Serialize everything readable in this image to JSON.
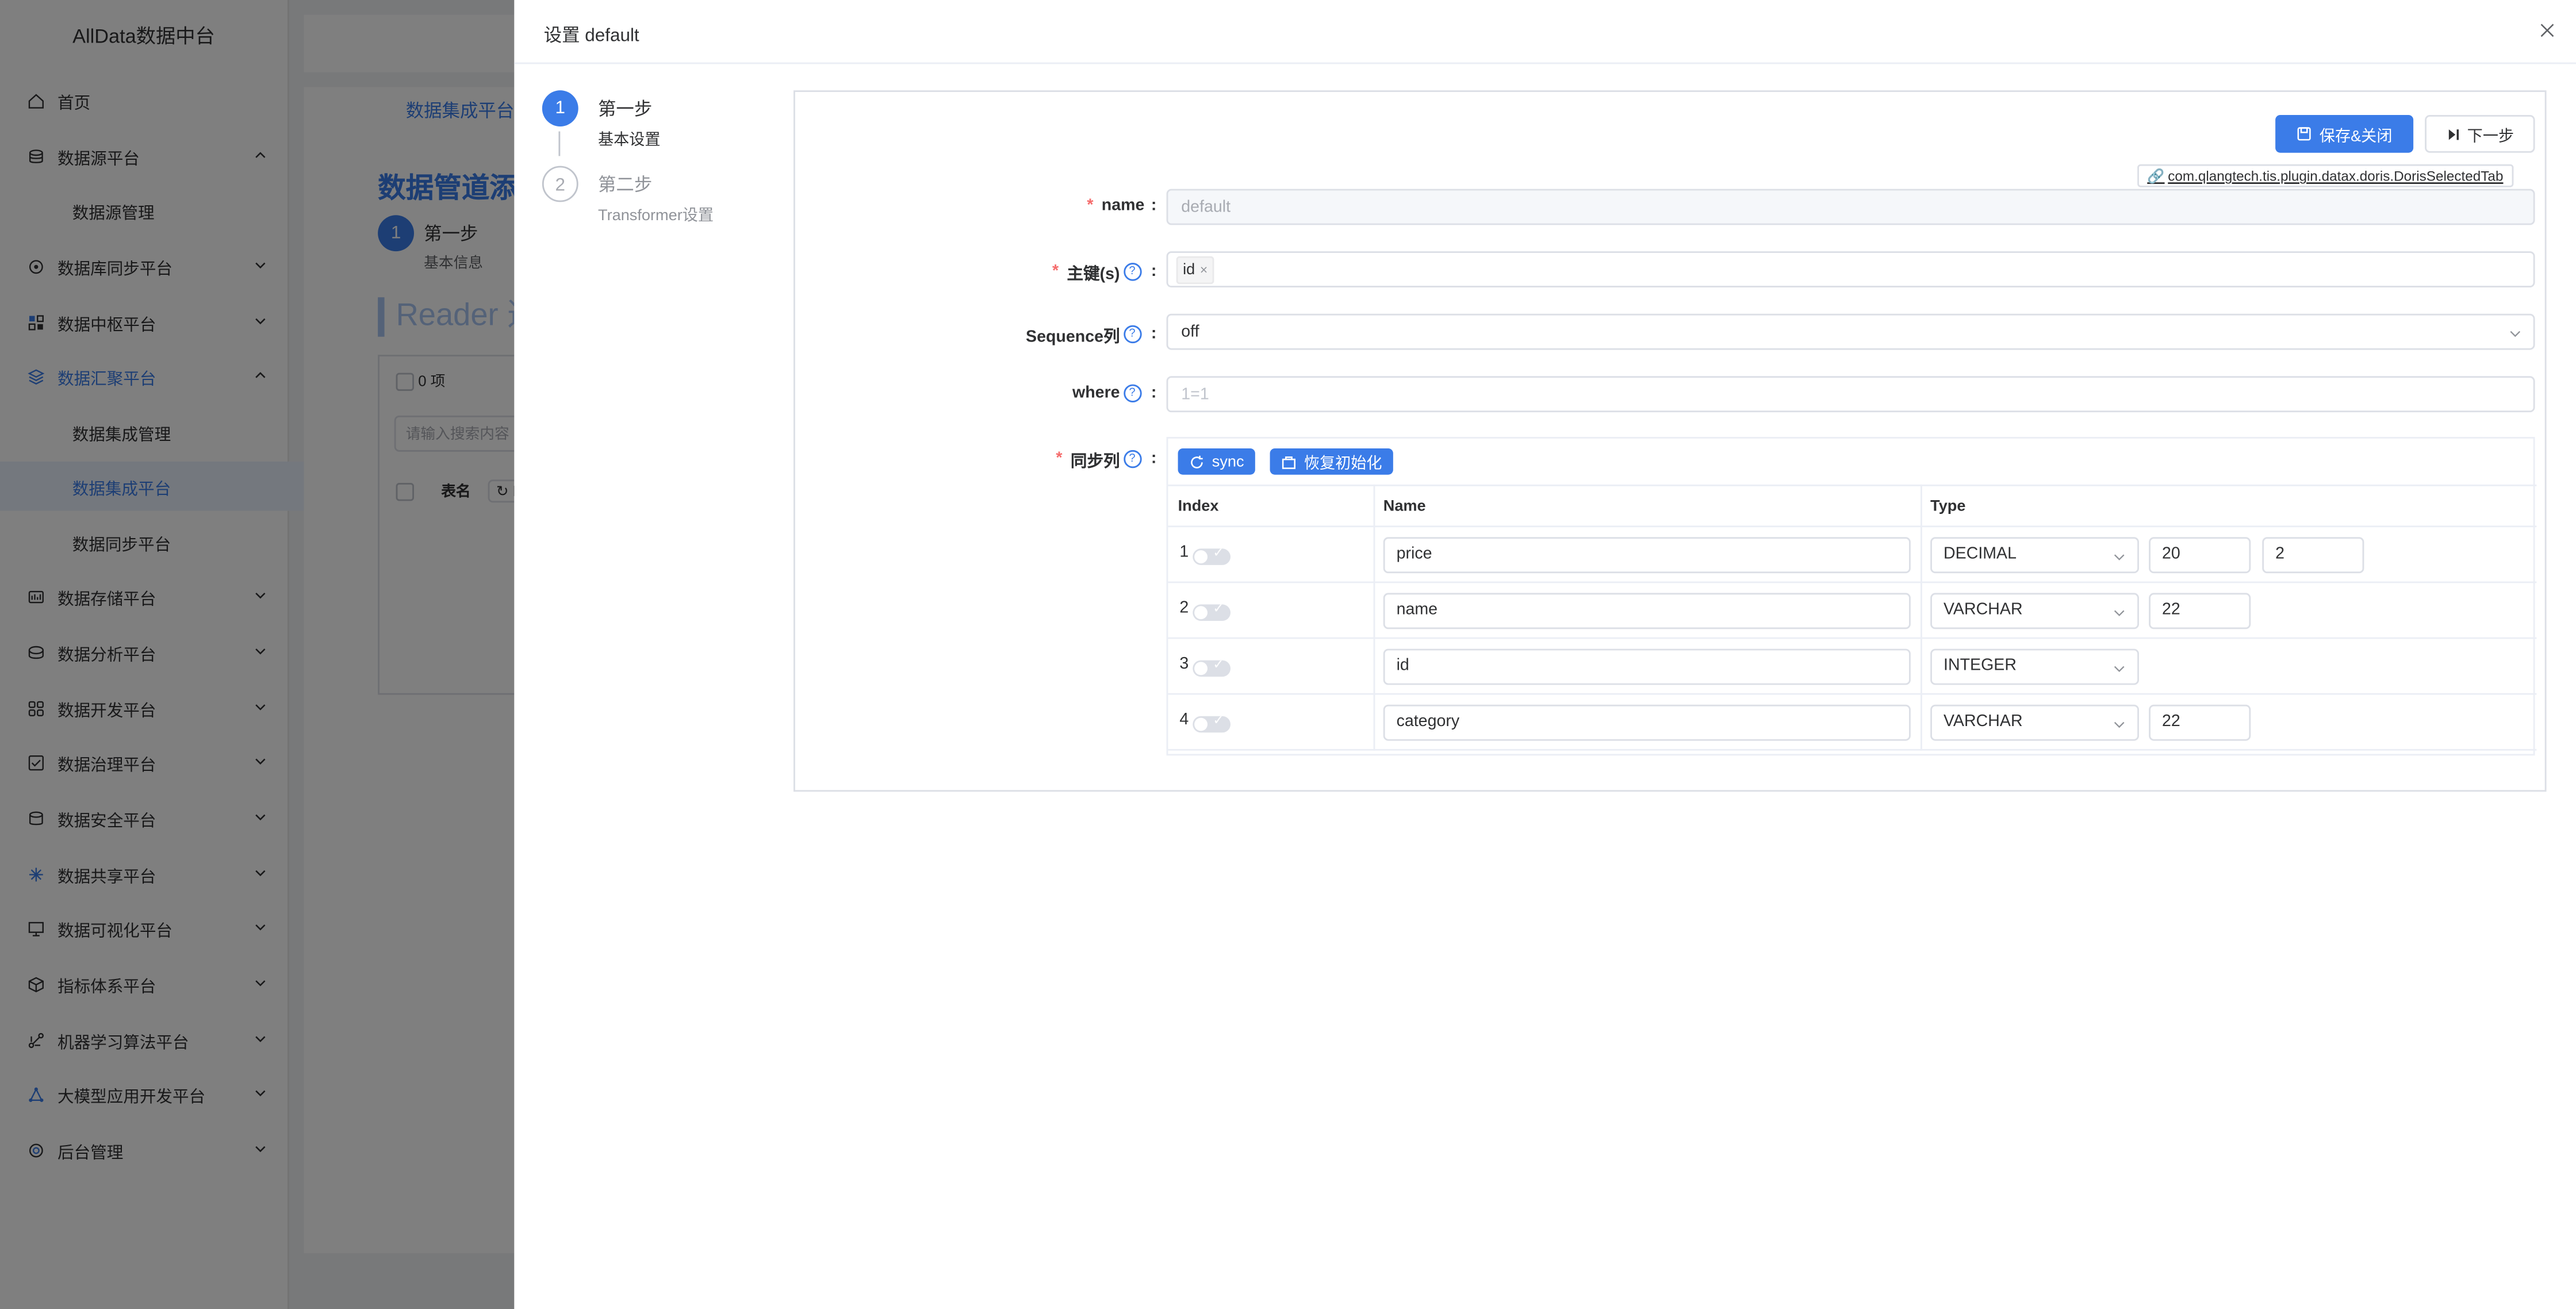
{
  "app": {
    "brand": "AllData数据中台"
  },
  "sidebar": {
    "items": [
      {
        "label": "首页",
        "icon": "home-icon"
      },
      {
        "label": "数据源平台",
        "icon": "database-icon"
      },
      {
        "label": "数据源管理",
        "sub": true
      },
      {
        "label": "数据库同步平台",
        "icon": "sync-db-icon"
      },
      {
        "label": "数据中枢平台",
        "icon": "hub-icon"
      },
      {
        "label": "数据汇聚平台",
        "icon": "layers-icon"
      },
      {
        "label": "数据集成管理",
        "sub": true
      },
      {
        "label": "数据集成平台",
        "sub": true,
        "active": true
      },
      {
        "label": "数据同步平台",
        "sub": true
      },
      {
        "label": "数据存储平台",
        "icon": "storage-icon"
      },
      {
        "label": "数据分析平台",
        "icon": "analysis-icon"
      },
      {
        "label": "数据开发平台",
        "icon": "dev-icon"
      },
      {
        "label": "数据治理平台",
        "icon": "governance-icon"
      },
      {
        "label": "数据安全平台",
        "icon": "security-icon"
      },
      {
        "label": "数据共享平台",
        "icon": "share-icon"
      },
      {
        "label": "数据可视化平台",
        "icon": "visual-icon"
      },
      {
        "label": "指标体系平台",
        "icon": "metrics-icon"
      },
      {
        "label": "机器学习算法平台",
        "icon": "ml-icon"
      },
      {
        "label": "大模型应用开发平台",
        "icon": "llm-icon"
      },
      {
        "label": "后台管理",
        "icon": "admin-icon"
      }
    ]
  },
  "background": {
    "tab": "数据集成平台",
    "title": "数据管道添加",
    "step_num": "1",
    "step_title": "第一步",
    "step_desc": "基本信息",
    "reader": "Reader 选",
    "count": "0 项",
    "search_placeholder": "请输入搜索内容",
    "table_col": "表名",
    "refresh_partial": "Re"
  },
  "drawer": {
    "title": "设置 default",
    "steps": [
      {
        "num": "1",
        "title": "第一步",
        "desc": "基本设置",
        "status": "active"
      },
      {
        "num": "2",
        "title": "第二步",
        "desc": "Transformer设置",
        "status": "wait"
      }
    ],
    "save_close": "保存&关闭",
    "next": "下一步",
    "plugin": "com.qlangtech.tis.plugin.datax.doris.DorisSelectedTab",
    "form": {
      "name_label": "name",
      "name_value": "default",
      "pk_label": "主键(s)",
      "pk_tag": "id",
      "seq_label": "Sequence列",
      "seq_value": "off",
      "where_label": "where",
      "where_placeholder": "1=1",
      "sync_label": "同步列",
      "sync_btn": "sync",
      "reset_btn": "恢复初始化",
      "colon": ":",
      "columns": {
        "index": "Index",
        "name": "Name",
        "type": "Type"
      },
      "rows": [
        {
          "index": "1",
          "name": "price",
          "type": "DECIMAL",
          "p1": "20",
          "p2": "2"
        },
        {
          "index": "2",
          "name": "name",
          "type": "VARCHAR",
          "p1": "22"
        },
        {
          "index": "3",
          "name": "id",
          "type": "INTEGER"
        },
        {
          "index": "4",
          "name": "category",
          "type": "VARCHAR",
          "p1": "22"
        }
      ]
    }
  },
  "colors": {
    "primary": "#3b7ce8",
    "required": "#f56c6c",
    "overlay": "rgba(0,0,0,0.5)"
  }
}
